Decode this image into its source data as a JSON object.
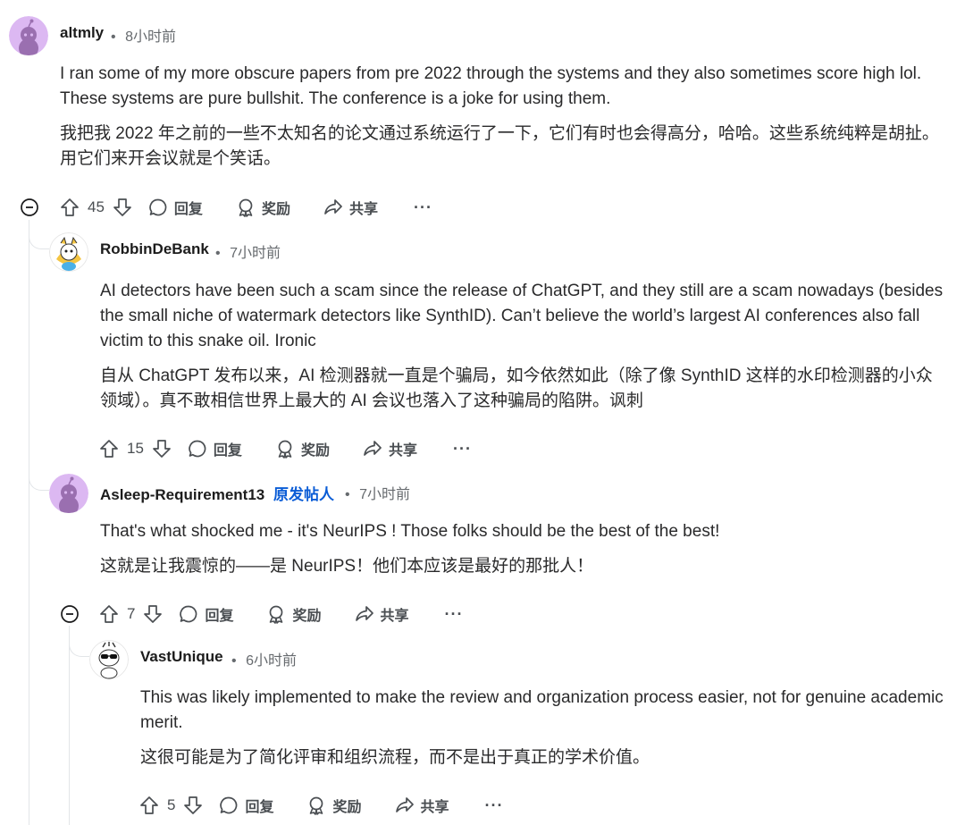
{
  "comments": [
    {
      "username": "altmly",
      "time": "8小时前",
      "text_en": "I ran some of my more obscure papers from pre 2022 through the systems and they also sometimes score high lol. These systems are pure bullshit. The conference is a joke for using them.",
      "text_zh": "我把我 2022 年之前的一些不太知名的论文通过系统运行了一下，它们有时也会得高分，哈哈。这些系统纯粹是胡扯。用它们来开会议就是个笑话。",
      "votes": "45"
    },
    {
      "username": "RobbinDeBank",
      "time": "7小时前",
      "text_en": "AI detectors have been such a scam since the release of ChatGPT, and they still are a scam nowadays (besides the small niche of watermark detectors like SynthID). Can’t believe the world’s largest AI conferences also fall victim to this snake oil. Ironic",
      "text_zh": "自从 ChatGPT 发布以来，AI 检测器就一直是个骗局，如今依然如此（除了像 SynthID 这样的水印检测器的小众领域）。真不敢相信世界上最大的 AI 会议也落入了这种骗局的陷阱。讽刺",
      "votes": "15"
    },
    {
      "username": "Asleep-Requirement13",
      "op_badge": "原发帖人",
      "time": "7小时前",
      "text_en": "That's what shocked me - it's NeurIPS ! Those folks should be the best of the best!",
      "text_zh": "这就是让我震惊的——是 NeurIPS！他们本应该是最好的那批人！",
      "votes": "7"
    },
    {
      "username": "VastUnique",
      "time": "6小时前",
      "text_en": "This was likely implemented to make the review and organization process easier, not for genuine academic merit.",
      "text_zh": "这很可能是为了简化评审和组织流程，而不是出于真正的学术价值。",
      "votes": "5"
    }
  ],
  "labels": {
    "separator": "•",
    "reply": "回复",
    "award": "奖励",
    "share": "共享",
    "more": "···"
  },
  "colors": {
    "op_badge": "#0a5cd6",
    "avatar_purple": "#d8b4f0",
    "thread_line": "#e2e5e8"
  }
}
